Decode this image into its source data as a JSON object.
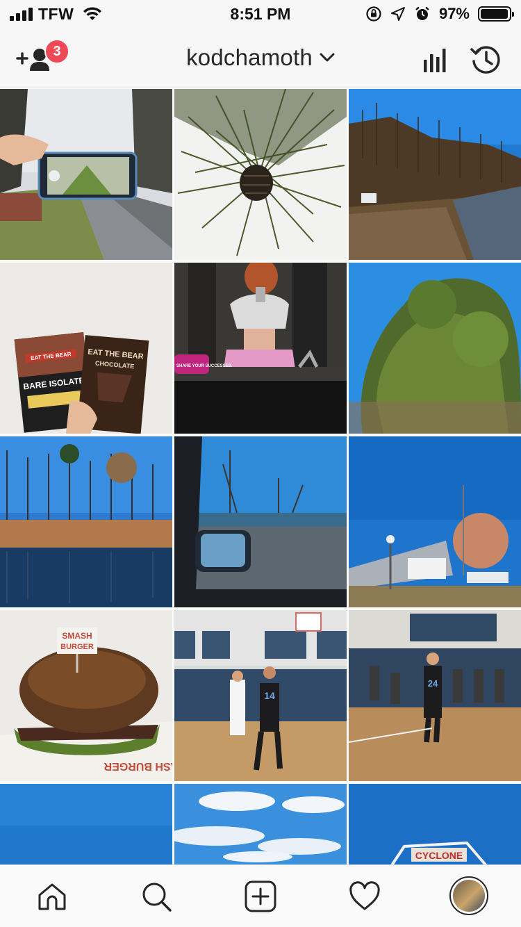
{
  "status_bar": {
    "carrier": "TFW",
    "time": "8:51 PM",
    "battery_percent": "97%",
    "battery_level": 0.97,
    "icons": [
      "signal-icon",
      "wifi-icon",
      "orientation-lock-icon",
      "location-icon",
      "alarm-icon",
      "battery-icon"
    ]
  },
  "header": {
    "username": "kodchamoth",
    "notification_count": "3",
    "icons": [
      "add-user-icon",
      "chevron-down-icon",
      "insights-icon",
      "archive-icon"
    ]
  },
  "grid": {
    "posts": [
      {
        "subject": "phone-road-photo"
      },
      {
        "subject": "pine-cone"
      },
      {
        "subject": "forest-truck"
      },
      {
        "subject": "protein-packets"
      },
      {
        "subject": "mirror-selfie"
      },
      {
        "subject": "pine-tree-sky"
      },
      {
        "subject": "lake-reflection"
      },
      {
        "subject": "car-mirror-water"
      },
      {
        "subject": "stadium-tree"
      },
      {
        "subject": "smash-burger"
      },
      {
        "subject": "basketball-game-1"
      },
      {
        "subject": "basketball-game-2"
      },
      {
        "subject": "blue-sky"
      },
      {
        "subject": "clouds-sky"
      },
      {
        "subject": "cyclone-coaster"
      }
    ],
    "texts": {
      "packet_bare": "BARE ISOLATE",
      "packet_eat": "EAT THE BEAR",
      "packet_choc": "CHOCOLATE",
      "packet_eat2": "EAT THE BEAR",
      "sign": "SHARE YOUR SUCCESSES.",
      "burger_flag_1": "SMASH",
      "burger_flag_2": "BURGER",
      "wrapper": "MASH BURGER",
      "coaster": "CYCLONE",
      "jersey_1": "14",
      "jersey_2": "24"
    }
  },
  "tab_bar": {
    "tabs": [
      "home-icon",
      "search-icon",
      "new-post-icon",
      "activity-icon",
      "profile-avatar"
    ]
  },
  "colors": {
    "badge": "#ed4956",
    "text": "#262626",
    "background": "#fafafa"
  }
}
